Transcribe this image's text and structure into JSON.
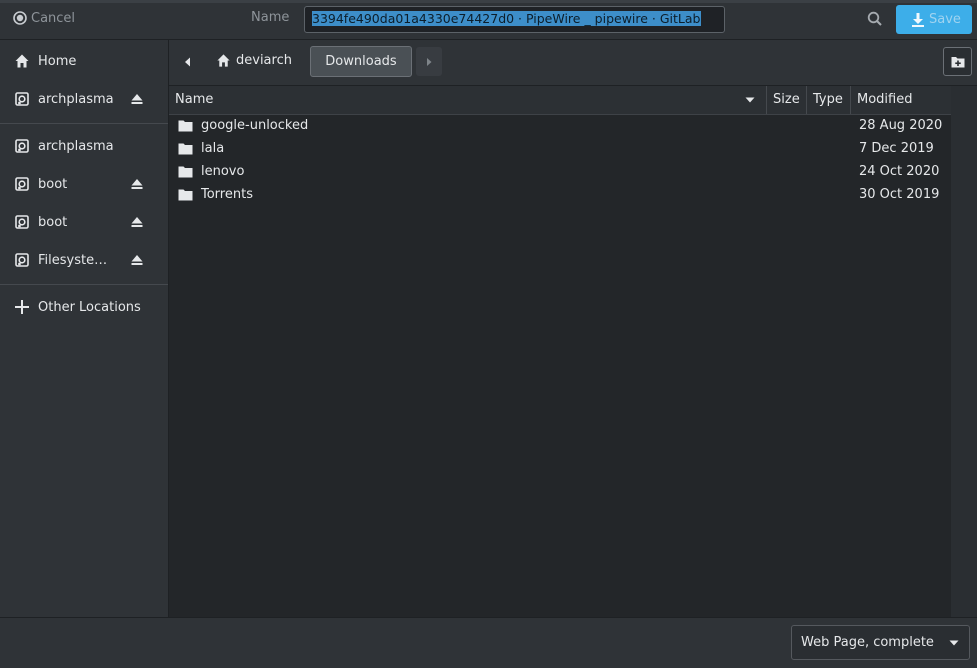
{
  "header": {
    "cancel_label": "Cancel",
    "name_label": "Name",
    "filename": "3394fe490da01a4330e74427d0 · PipeWire _ pipewire · GitLab",
    "save_label": "Save"
  },
  "sidebar": {
    "items": [
      {
        "label": "Home",
        "icon": "home-icon",
        "eject": false
      },
      {
        "label": "archplasma",
        "icon": "drive-icon",
        "eject": true
      },
      {
        "label": "archplasma",
        "icon": "drive-icon",
        "eject": false
      },
      {
        "label": "boot",
        "icon": "drive-icon",
        "eject": true
      },
      {
        "label": "boot",
        "icon": "drive-icon",
        "eject": true
      },
      {
        "label": "Filesyste…",
        "icon": "drive-icon",
        "eject": true
      },
      {
        "label": "Other Locations",
        "icon": "plus-icon",
        "eject": false
      }
    ]
  },
  "pathbar": {
    "home_label": "deviarch",
    "current_label": "Downloads"
  },
  "columns": {
    "name": "Name",
    "size": "Size",
    "type": "Type",
    "modified": "Modified"
  },
  "files": [
    {
      "name": "google-unlocked",
      "modified": "28 Aug 2020"
    },
    {
      "name": "lala",
      "modified": "7 Dec 2019"
    },
    {
      "name": "lenovo",
      "modified": "24 Oct 2020"
    },
    {
      "name": "Torrents",
      "modified": "30 Oct 2019"
    }
  ],
  "footer": {
    "filter_value": "Web Page, complete"
  },
  "colors": {
    "accent": "#3daee9",
    "background": "#2a2e32",
    "list_background": "#232629"
  }
}
